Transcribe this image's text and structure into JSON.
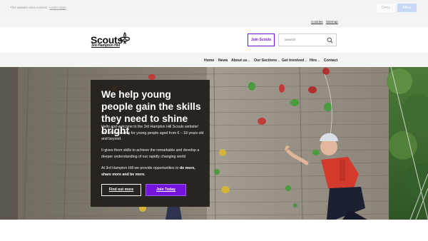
{
  "cookie_bar": {
    "text": "This website uses cookies",
    "link": "Learn more",
    "deny_label": "Deny",
    "allow_label": "Allow"
  },
  "utility_nav": {
    "cookies": "Cookies",
    "sitemap": "Sitemap"
  },
  "header": {
    "logo_word": "Scouts",
    "logo_sub": "3rd Hampton Hill",
    "join_label": "Join Scouts",
    "search_placeholder": "Search"
  },
  "main_nav": {
    "items": [
      {
        "label": "Home"
      },
      {
        "label": "News"
      },
      {
        "label": "About us"
      },
      {
        "label": "Our Sections"
      },
      {
        "label": "Get Involved"
      },
      {
        "label": "Hire"
      },
      {
        "label": "Contact"
      }
    ]
  },
  "hero": {
    "title": "We help young people gain the skills they need to shine bright",
    "p1": "Hello and welcome to the 3rd Hampton Hill Scouts website! We offer scouting for young people aged from 6 – 18 years old and beyond.",
    "p2": "It gives them skills to achieve the remarkable and develop a deeper understanding of our rapidly changing world",
    "p3_lead": "At 3rd Hampton Hill we provide opportunities to ",
    "p3_bold": "do more, share more and be more.",
    "find_label": "Find out more",
    "join_label": "Join Today"
  },
  "colors": {
    "brand_purple": "#7413dc",
    "card_bg": "#211c19",
    "nav_bg": "#f4f4f4"
  }
}
